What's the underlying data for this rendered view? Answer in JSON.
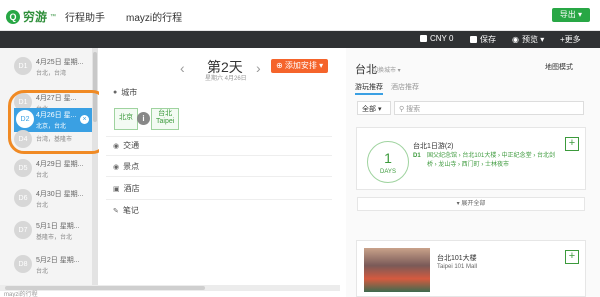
{
  "header": {
    "logo_mark": "Q",
    "logo_text": "穷游",
    "logo_tm": "™",
    "app_name": "行程助手",
    "trip_title": "mayzi的行程",
    "export_label": "导出 ▾"
  },
  "toolbar": {
    "currency": "CNY 0",
    "save": "保存",
    "preview": "预览 ▾",
    "more": "+更多"
  },
  "days": [
    {
      "badge": "D1",
      "date": "4月25日 星期...",
      "cities": "台北，台湾"
    },
    {
      "badge": "D1",
      "date": "4月27日 星...",
      "cities": "台北"
    },
    {
      "badge": "D2",
      "date": "4月26日 星...",
      "cities": "北京，台北"
    },
    {
      "badge": "D4",
      "date": "",
      "cities": "台湾，基隆市"
    },
    {
      "badge": "D5",
      "date": "4月29日 星期...",
      "cities": "台北"
    },
    {
      "badge": "D6",
      "date": "4月30日 星期...",
      "cities": "台北"
    },
    {
      "badge": "D7",
      "date": "5月1日 星期...",
      "cities": "基隆市，台北"
    },
    {
      "badge": "D8",
      "date": "5月2日 星期...",
      "cities": "台北"
    }
  ],
  "middle": {
    "day_title": "第2天",
    "day_sub": "星期六 4月26日",
    "prev": "‹",
    "next": "›",
    "add_label": "⊕ 添加安排 ▾",
    "sec_city": "城市",
    "sec_traffic": "交通",
    "sec_poi": "景点",
    "sec_hotel": "酒店",
    "sec_note": "笔记",
    "city_tags": [
      "北京",
      "台北\nTaipei"
    ],
    "info": "i"
  },
  "right": {
    "city": "台北",
    "switch": "切换城市 ▾",
    "map_mode": "地图模式",
    "tabs": [
      "游玩推荐",
      "酒店推荐"
    ],
    "filter": "全部 ▾",
    "search_placeholder": "搜索",
    "plan": {
      "days_num": "1",
      "days_lbl": "DAYS",
      "title": "台北1日游(2)",
      "d1": "D1",
      "pois": "国父纪念馆 › 台北101大楼 › 中正纪念堂 › 台北剑桥 › 龙山寺 › 西门町 › 士林夜市"
    },
    "expand": "▾ 展开全部",
    "poi": {
      "name": "台北101大楼",
      "en": "Taipei 101 Mall"
    },
    "plus": "+"
  },
  "status": {
    "text": "mayzi的行程"
  }
}
